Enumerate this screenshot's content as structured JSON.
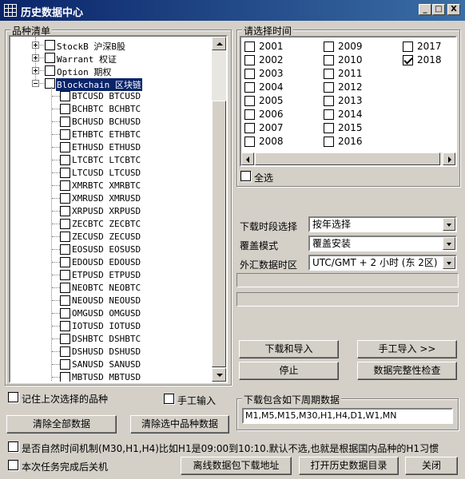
{
  "window": {
    "title": "历史数据中心",
    "min": "_",
    "max": "□",
    "close": "X"
  },
  "tree": {
    "title": "品种清单",
    "groups": [
      {
        "label": "StockB 沪深B股"
      },
      {
        "label": "Warrant 权证"
      },
      {
        "label": "Option 期权"
      },
      {
        "label": "Blockchain 区块链"
      }
    ],
    "items": [
      "BTCUSD BTCUSD",
      "BCHBTC BCHBTC",
      "BCHUSD BCHUSD",
      "ETHBTC ETHBTC",
      "ETHUSD ETHUSD",
      "LTCBTC LTCBTC",
      "LTCUSD LTCUSD",
      "XMRBTC XMRBTC",
      "XMRUSD XMRUSD",
      "XRPUSD XRPUSD",
      "ZECBTC ZECBTC",
      "ZECUSD ZECUSD",
      "EOSUSD EOSUSD",
      "EDOUSD EDOUSD",
      "ETPUSD ETPUSD",
      "NEOBTC NEOBTC",
      "NEOUSD NEOUSD",
      "OMGUSD OMGUSD",
      "IOTUSD IOTUSD",
      "DSHBTC DSHBTC",
      "DSHUSD DSHUSD",
      "SANUSD SANUSD",
      "MBTUSD MBTUSD"
    ]
  },
  "remember": "记住上次选择的品种",
  "manual_input": "手工输入",
  "clear_all": "清除全部数据",
  "clear_selected": "清除选中品种数据",
  "years": {
    "title": "请选择时间",
    "col1": [
      "2001",
      "2002",
      "2003",
      "2004",
      "2005",
      "2006",
      "2007",
      "2008"
    ],
    "col2": [
      "2009",
      "2010",
      "2011",
      "2012",
      "2013",
      "2014",
      "2015",
      "2016"
    ],
    "col3": [
      "2017",
      "2018"
    ],
    "checked": "2018",
    "select_all": "全选"
  },
  "form": {
    "period_label": "下载时段选择",
    "period_value": "按年选择",
    "mode_label": "覆盖模式",
    "mode_value": "覆盖安装",
    "tz_label": "外汇数据时区",
    "tz_value": "UTC/GMT + 2 小时 (东 2区)"
  },
  "buttons": {
    "download_import": "下载和导入",
    "manual_import": "手工导入 >>",
    "stop": "停止",
    "integrity": "数据完整性检查",
    "offline": "离线数据包下载地址",
    "open_dir": "打开历史数据目录",
    "close": "关闭"
  },
  "periods": {
    "title": "下载包含如下周期数据",
    "value": "M1,M5,M15,M30,H1,H4,D1,W1,MN"
  },
  "natural_time": "是否自然时间机制(M30,H1,H4)比如H1是09:00到10:10.默认不选,也就是根据国内品种的H1习惯",
  "shutdown": "本次任务完成后关机"
}
